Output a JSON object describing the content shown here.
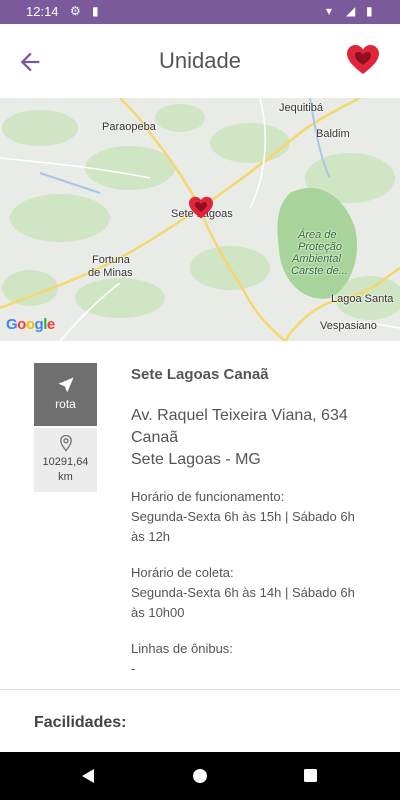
{
  "statusbar": {
    "time": "12:14"
  },
  "header": {
    "title": "Unidade"
  },
  "map": {
    "attribution": "Google",
    "labels": {
      "jequitiba": "Jequitibá",
      "paraopeba": "Paraopeba",
      "baldim": "Baldim",
      "sete_lagoas": "Sete Lagoas",
      "area_protecao": [
        "Área de",
        "Proteção",
        "Ambiental",
        "Carste de..."
      ],
      "fortuna_1": "Fortuna",
      "fortuna_2": "de Minas",
      "lagoa_santa": "Lagoa Santa",
      "vespasiano": "Vespasiano"
    }
  },
  "unit": {
    "name": "Sete Lagoas Canaã",
    "address_line1": "Av. Raquel Teixeira Viana, 634",
    "address_line2": "Canaã",
    "address_line3": "Sete Lagoas - MG",
    "opening_label": "Horário de funcionamento:",
    "opening_hours": "Segunda-Sexta 6h às 15h | Sábado 6h às 12h",
    "collection_label": "Horário de coleta:",
    "collection_hours": "Segunda-Sexta 6h às 14h | Sábado 6h às 10h00",
    "bus_label": "Linhas de ônibus:",
    "bus_lines": "-"
  },
  "actions": {
    "route_label": "rota",
    "distance_value": "10291,64",
    "distance_unit": "km"
  },
  "facilities": {
    "title": "Facilidades:"
  },
  "colors": {
    "primary": "#7b5a9b",
    "favorite": "#e0243a"
  },
  "icons": {
    "back": "arrow-left-icon",
    "favorite": "heart-icon",
    "route": "navigation-arrow-icon",
    "distance": "location-pin-icon"
  }
}
